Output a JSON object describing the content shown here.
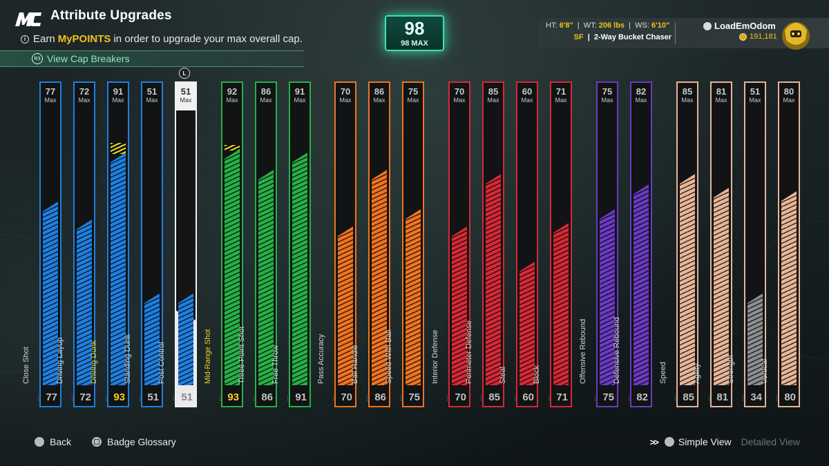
{
  "header": {
    "logo": "MC",
    "title": "Attribute Upgrades",
    "subtitle_prefix": "Earn",
    "subtitle_highlight": "MyPOINTS",
    "subtitle_suffix": "in order to upgrade your max overall cap.",
    "cap_breakers_button": "R3",
    "cap_breakers_label": "View Cap Breakers"
  },
  "overall": {
    "value": "98",
    "max_label": "98 MAX"
  },
  "player": {
    "ht_label": "HT:",
    "ht_value": "6'8\"",
    "wt_label": "WT:",
    "wt_value": "206 lbs",
    "ws_label": "WS:",
    "ws_value": "6'10\"",
    "position": "SF",
    "archetype": "2-Way Bucket Chaser",
    "username": "LoadEmOdom",
    "vc": "191,181"
  },
  "colors": {
    "finishing": "#1f7fe0",
    "shooting": "#27b048",
    "playmaking": "#ee7422",
    "defense": "#d42a36",
    "rebounding": "#6a3bc2",
    "physicals": "#e8b698",
    "boost": "#f5e11a",
    "accent": "#3de0b0"
  },
  "selected_button": "L",
  "attributes": [
    {
      "name": "Close Shot",
      "max": "77",
      "current": "77",
      "value": 77,
      "group": "finishing",
      "hl": false
    },
    {
      "name": "Driving Layup",
      "max": "72",
      "current": "72",
      "value": 72,
      "group": "finishing",
      "hl": false
    },
    {
      "name": "Driving Dunk",
      "max": "91",
      "current": "93",
      "value": 91,
      "boost": 2,
      "group": "finishing",
      "hl": true
    },
    {
      "name": "Standing Dunk",
      "max": "51",
      "current": "51",
      "value": 51,
      "group": "finishing",
      "hl": false
    },
    {
      "name": "Post Control",
      "max": "51",
      "current": "51",
      "value": 51,
      "group": "finishing",
      "hl": false,
      "selected": true
    },
    {
      "name": "Mid-Range Shot",
      "max": "92",
      "current": "93",
      "value": 92,
      "boost": 1,
      "group": "shooting",
      "hl": true
    },
    {
      "name": "Three-Point Shot",
      "max": "86",
      "current": "86",
      "value": 86,
      "group": "shooting",
      "hl": false
    },
    {
      "name": "Free Throw",
      "max": "91",
      "current": "91",
      "value": 91,
      "group": "shooting",
      "hl": false
    },
    {
      "name": "Pass Accuracy",
      "max": "70",
      "current": "70",
      "value": 70,
      "group": "playmaking",
      "hl": false
    },
    {
      "name": "Ball Handle",
      "max": "86",
      "current": "86",
      "value": 86,
      "group": "playmaking",
      "hl": false
    },
    {
      "name": "Speed With Ball",
      "max": "75",
      "current": "75",
      "value": 75,
      "group": "playmaking",
      "hl": false
    },
    {
      "name": "Interior Defense",
      "max": "70",
      "current": "70",
      "value": 70,
      "group": "defense",
      "hl": false
    },
    {
      "name": "Perimeter Defense",
      "max": "85",
      "current": "85",
      "value": 85,
      "group": "defense",
      "hl": false
    },
    {
      "name": "Steal",
      "max": "60",
      "current": "60",
      "value": 60,
      "group": "defense",
      "hl": false
    },
    {
      "name": "Block",
      "max": "71",
      "current": "71",
      "value": 71,
      "group": "defense",
      "hl": false
    },
    {
      "name": "Offensive Rebound",
      "max": "75",
      "current": "75",
      "value": 75,
      "group": "rebounding",
      "hl": false
    },
    {
      "name": "Defensive Rebound",
      "max": "82",
      "current": "82",
      "value": 82,
      "group": "rebounding",
      "hl": false
    },
    {
      "name": "Speed",
      "max": "85",
      "current": "85",
      "value": 85,
      "group": "physicals",
      "hl": false
    },
    {
      "name": "Agility",
      "max": "81",
      "current": "81",
      "value": 81,
      "group": "physicals",
      "hl": false
    },
    {
      "name": "Strength",
      "max": "51",
      "current": "34",
      "value": 51,
      "group": "physicals",
      "hl": false,
      "gray": true
    },
    {
      "name": "Vertical",
      "max": "80",
      "current": "80",
      "value": 80,
      "group": "physicals",
      "hl": false
    }
  ],
  "max_word": "Max",
  "footer": {
    "back_label": "Back",
    "glossary_label": "Badge Glossary",
    "simple_view_label": "Simple View",
    "detailed_view_label": "Detailed View"
  }
}
